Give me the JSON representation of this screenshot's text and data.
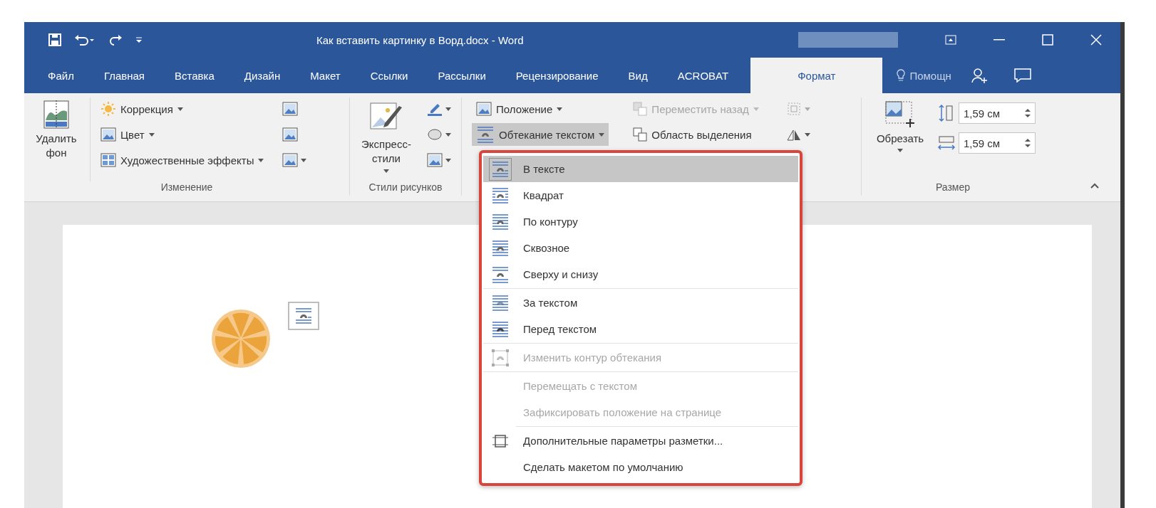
{
  "window": {
    "title": "Как вставить картинку в Ворд.docx - Word"
  },
  "tabs": [
    {
      "label": "Файл",
      "selected": false
    },
    {
      "label": "Главная",
      "selected": false
    },
    {
      "label": "Вставка",
      "selected": false
    },
    {
      "label": "Дизайн",
      "selected": false
    },
    {
      "label": "Макет",
      "selected": false
    },
    {
      "label": "Ссылки",
      "selected": false
    },
    {
      "label": "Рассылки",
      "selected": false
    },
    {
      "label": "Рецензирование",
      "selected": false
    },
    {
      "label": "Вид",
      "selected": false
    },
    {
      "label": "ACROBAT",
      "selected": false
    },
    {
      "label": "Формат",
      "selected": true
    }
  ],
  "help": {
    "label": "Помощн"
  },
  "ribbon": {
    "adjust": {
      "remove_background": "Удалить фон",
      "commands": [
        {
          "label": "Коррекция",
          "kind": "sun"
        },
        {
          "label": "Цвет",
          "kind": "color"
        },
        {
          "label": "Художественные эффекты",
          "kind": "effects"
        }
      ],
      "group_label": "Изменение"
    },
    "styles": {
      "quick_styles": "Экспресс-стили",
      "group_label": "Стили рисунков"
    },
    "arrange": {
      "commands": [
        {
          "label": "Положение",
          "pressed": false,
          "disabled": false
        },
        {
          "label": "Обтекание текстом",
          "pressed": true,
          "disabled": false
        }
      ],
      "commands_2": [
        {
          "label": "Переместить назад",
          "pressed": false,
          "disabled": true
        },
        {
          "label": "Область выделения",
          "pressed": false,
          "disabled": false
        }
      ]
    },
    "size": {
      "crop": "Обрезать",
      "height": "1,59 см",
      "width": "1,59 см",
      "group_label": "Размер"
    }
  },
  "wrap_menu": [
    {
      "label": "В тексте",
      "kind": "inline",
      "selected": true,
      "disabled": false,
      "separator_before": false
    },
    {
      "label": "Квадрат",
      "kind": "square",
      "selected": false,
      "disabled": false,
      "separator_before": false
    },
    {
      "label": "По контуру",
      "kind": "tight",
      "selected": false,
      "disabled": false,
      "separator_before": false
    },
    {
      "label": "Сквозное",
      "kind": "through",
      "selected": false,
      "disabled": false,
      "separator_before": false
    },
    {
      "label": "Сверху и снизу",
      "kind": "topbottom",
      "selected": false,
      "disabled": false,
      "separator_before": false
    },
    {
      "label": "За текстом",
      "kind": "behind",
      "selected": false,
      "disabled": false,
      "separator_before": true
    },
    {
      "label": "Перед текстом",
      "kind": "front",
      "selected": false,
      "disabled": false,
      "separator_before": false
    },
    {
      "label": "Изменить контур обтекания",
      "kind": "editpoints",
      "selected": false,
      "disabled": true,
      "separator_before": true
    },
    {
      "label": "Перемещать с текстом",
      "kind": "none",
      "selected": false,
      "disabled": true,
      "separator_before": true
    },
    {
      "label": "Зафиксировать положение на странице",
      "kind": "none",
      "selected": false,
      "disabled": true,
      "separator_before": false
    },
    {
      "label": "Дополнительные параметры разметки...",
      "kind": "layout",
      "selected": false,
      "disabled": false,
      "separator_before": true
    },
    {
      "label": "Сделать макетом по умолчанию",
      "kind": "none",
      "selected": false,
      "disabled": false,
      "separator_before": false
    }
  ]
}
